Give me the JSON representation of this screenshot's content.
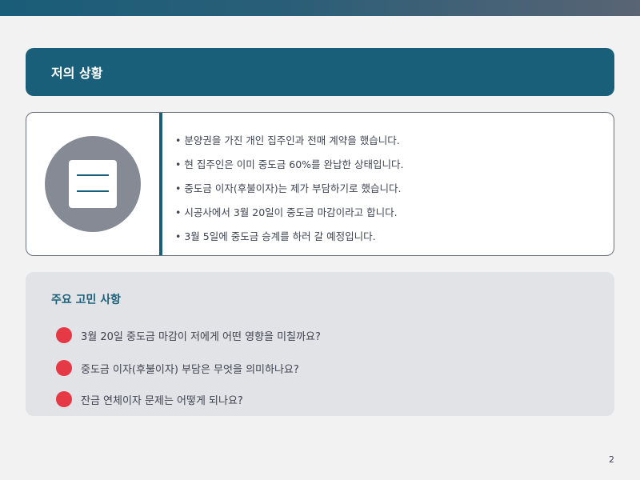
{
  "header": {
    "title": "저의 상황"
  },
  "situation": {
    "icon": "document-icon",
    "items": [
      "분양권을 가진 개인 집주인과 전매 계약을 했습니다.",
      "현 집주인은 이미 중도금 60%를 완납한 상태입니다.",
      "중도금 이자(후불이자)는 제가 부담하기로 했습니다.",
      "시공사에서 3월 20일이 중도금 마감이라고 합니다.",
      "3월 5일에 중도금 승계를 하러 갈 예정입니다."
    ]
  },
  "concerns": {
    "title": "주요 고민 사항",
    "items": [
      "3월 20일 중도금 마감이 저에게 어떤 영향을 미칠까요?",
      "중도금 이자(후불이자) 부담은 무엇을 의미하나요?",
      "잔금 연체이자 문제는 어떻게 되나요?"
    ]
  },
  "footer": {
    "page_number": "2"
  },
  "colors": {
    "primary": "#1a5f7a",
    "accent": "#e63946",
    "icon_gray": "#858a95"
  }
}
